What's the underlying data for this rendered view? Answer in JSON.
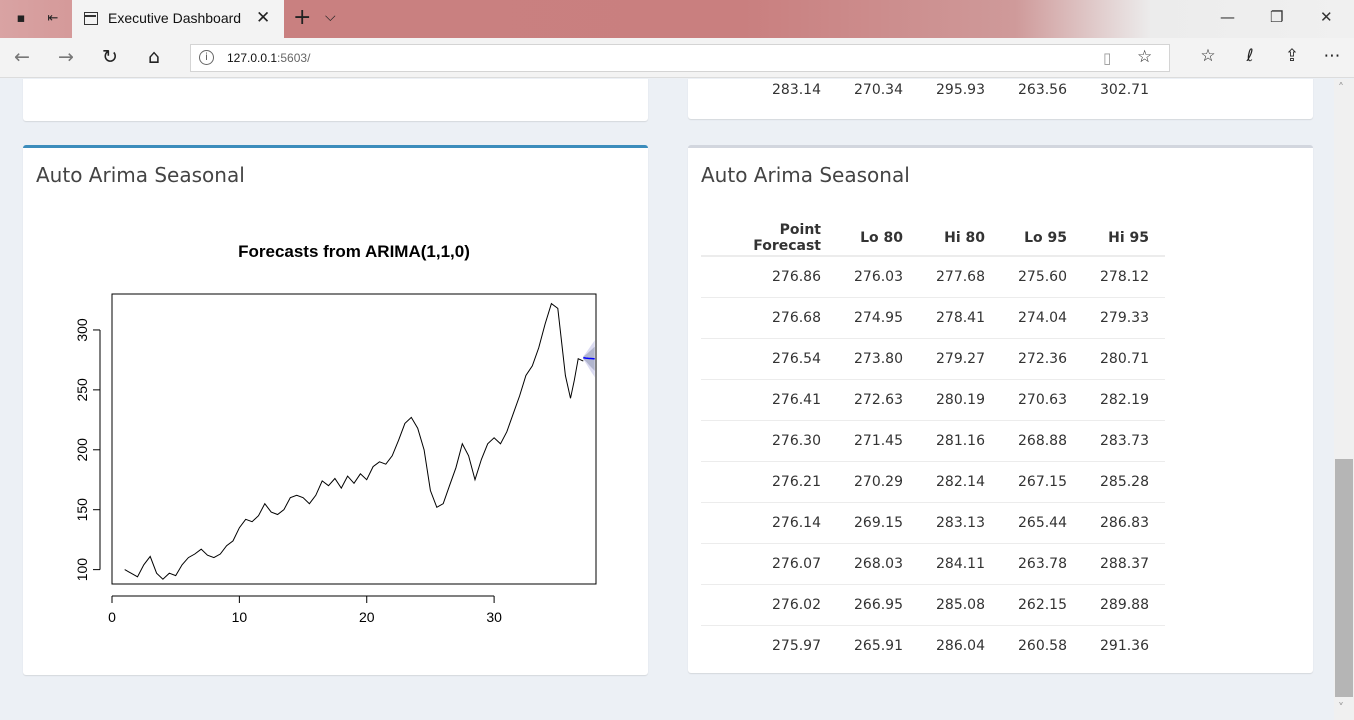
{
  "browser": {
    "tab_title": "Executive Dashboard",
    "url_host": "127.0.0.1",
    "url_port": ":5603/",
    "glyphs": {
      "tab_close": "✕",
      "new_tab": "+",
      "tab_list": "⌵",
      "minimize": "—",
      "restore": "❐",
      "close_window": "✕",
      "back": "←",
      "forward": "→",
      "refresh": "↻",
      "home": "⌂",
      "info": "i",
      "reading_view": "▯",
      "favorite": "☆",
      "favorites_hub": "☆",
      "pen": "ℓ",
      "share": "⇪",
      "more": "⋯",
      "scroll_up": "˄",
      "scroll_down": "˅"
    }
  },
  "top_table": {
    "row": [
      "283.14",
      "270.34",
      "295.93",
      "263.56",
      "302.71"
    ]
  },
  "left_box": {
    "title": "Auto Arima Seasonal"
  },
  "right_box": {
    "title": "Auto Arima Seasonal",
    "columns": [
      "Point Forecast",
      "Lo 80",
      "Hi 80",
      "Lo 95",
      "Hi 95"
    ],
    "rows": [
      [
        "276.86",
        "276.03",
        "277.68",
        "275.60",
        "278.12"
      ],
      [
        "276.68",
        "274.95",
        "278.41",
        "274.04",
        "279.33"
      ],
      [
        "276.54",
        "273.80",
        "279.27",
        "272.36",
        "280.71"
      ],
      [
        "276.41",
        "272.63",
        "280.19",
        "270.63",
        "282.19"
      ],
      [
        "276.30",
        "271.45",
        "281.16",
        "268.88",
        "283.73"
      ],
      [
        "276.21",
        "270.29",
        "282.14",
        "267.15",
        "285.28"
      ],
      [
        "276.14",
        "269.15",
        "283.13",
        "265.44",
        "286.83"
      ],
      [
        "276.07",
        "268.03",
        "284.11",
        "263.78",
        "288.37"
      ],
      [
        "276.02",
        "266.95",
        "285.08",
        "262.15",
        "289.88"
      ],
      [
        "275.97",
        "265.91",
        "286.04",
        "260.58",
        "291.36"
      ]
    ]
  },
  "colors": {
    "accent_blue": "#3c8dbc",
    "forecast_line": "#0000ff",
    "interval_95": "#dbdbf2",
    "interval_80": "#b1b5ce"
  },
  "chart_data": {
    "type": "line",
    "title": "Forecasts from ARIMA(1,1,0)",
    "xlabel": "",
    "ylabel": "",
    "xlim": [
      0,
      38
    ],
    "ylim": [
      88,
      330
    ],
    "x_ticks": [
      0,
      10,
      20,
      30
    ],
    "y_ticks": [
      100,
      150,
      200,
      250,
      300
    ],
    "grid": false,
    "series": [
      {
        "x": [
          1.0,
          1.5,
          2.0,
          2.5,
          3.0,
          3.5,
          4.0,
          4.5,
          5.0,
          5.5,
          6.0,
          6.5,
          7.0,
          7.5,
          8.0,
          8.5,
          9.0,
          9.5,
          10.0,
          10.5,
          11.0,
          11.5,
          12.0,
          12.5,
          13.0,
          13.5,
          14.0,
          14.5,
          15.0,
          15.5,
          16.0,
          16.5,
          17.0,
          17.5,
          18.0,
          18.5,
          19.0,
          19.5,
          20.0,
          20.5,
          21.0,
          21.5,
          22.0,
          22.5,
          23.0,
          23.5,
          24.0,
          24.5,
          25.0,
          25.5,
          26.0,
          26.5,
          27.0,
          27.5,
          28.0,
          28.5,
          29.0,
          29.5,
          30.0,
          30.5,
          31.0,
          31.5,
          32.0,
          32.5,
          33.0,
          33.5,
          34.0,
          34.5,
          35.0,
          35.3,
          35.6,
          36.0,
          36.3,
          36.6,
          37.0
        ],
        "values": [
          100,
          97,
          94,
          104,
          111,
          97,
          92,
          97,
          95,
          104,
          110,
          113,
          117,
          112,
          110,
          113,
          120,
          124,
          135,
          142,
          140,
          145,
          155,
          148,
          146,
          150,
          160,
          162,
          160,
          155,
          162,
          174,
          170,
          176,
          168,
          178,
          172,
          180,
          175,
          186,
          190,
          188,
          195,
          208,
          222,
          227,
          218,
          200,
          166,
          152,
          155,
          170,
          185,
          205,
          195,
          175,
          192,
          205,
          210,
          205,
          215,
          230,
          245,
          262,
          270,
          285,
          305,
          322,
          318,
          290,
          262,
          243,
          258,
          276,
          274
        ]
      },
      {
        "name": "",
        "x": [
          37.0,
          37.1,
          37.2,
          37.3,
          37.4,
          37.5,
          37.6,
          37.7,
          37.8,
          37.9
        ],
        "values": [
          276.86,
          276.68,
          276.54,
          276.41,
          276.3,
          276.21,
          276.14,
          276.07,
          276.02,
          275.97
        ]
      }
    ]
  }
}
